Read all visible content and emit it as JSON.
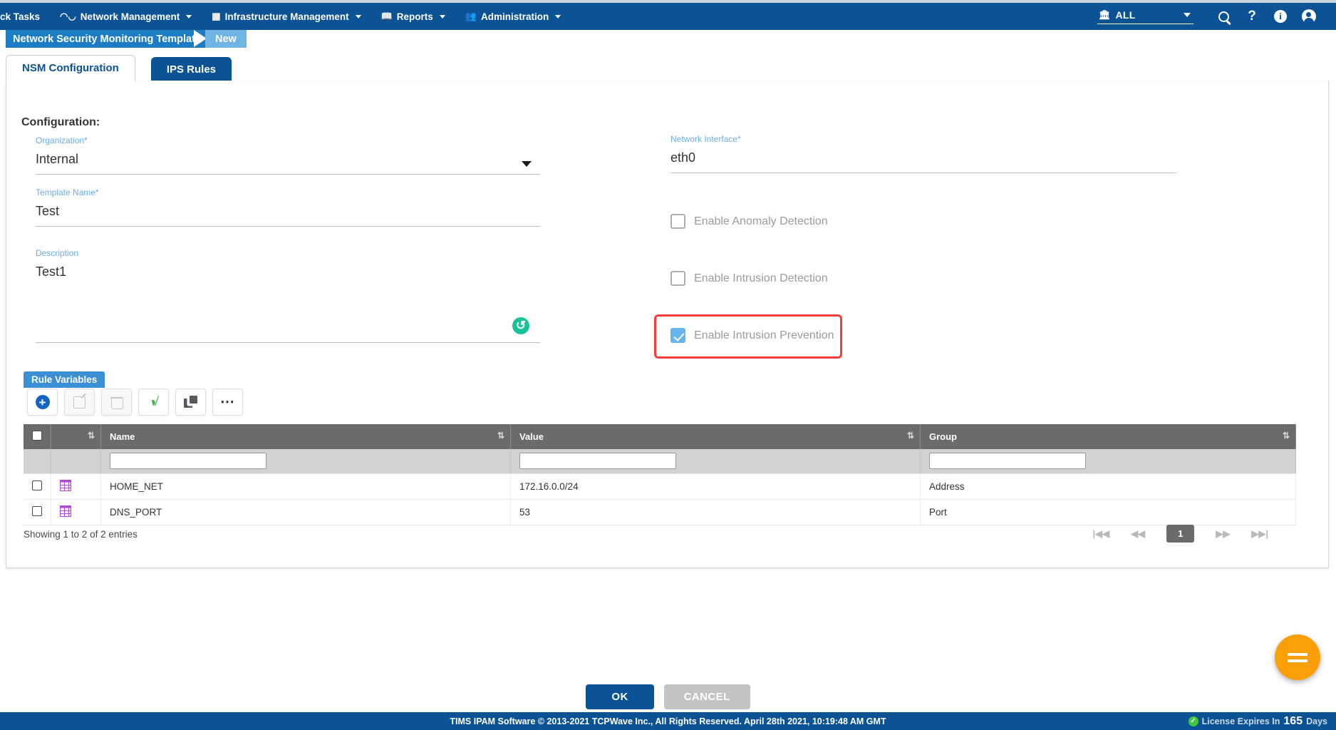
{
  "nav": {
    "items": [
      {
        "label": "ck Tasks",
        "icon": "",
        "caret": false
      },
      {
        "label": "Network Management",
        "icon": "network-icon",
        "caret": true
      },
      {
        "label": "Infrastructure Management",
        "icon": "grid-icon",
        "caret": true
      },
      {
        "label": "Reports",
        "icon": "book-icon",
        "caret": true
      },
      {
        "label": "Administration",
        "icon": "users-icon",
        "caret": true
      }
    ],
    "org_scope": "ALL",
    "right_icons": [
      "search-icon",
      "help-icon",
      "info-icon",
      "user-avatar-icon"
    ]
  },
  "breadcrumb": {
    "parent": "Network Security Monitoring Template",
    "current": "New"
  },
  "tabs": [
    {
      "label": "NSM Configuration",
      "active": true
    },
    {
      "label": "IPS Rules",
      "active": false
    }
  ],
  "form": {
    "section_title": "Configuration:",
    "organization": {
      "label": "Organization*",
      "value": "Internal"
    },
    "template_name": {
      "label": "Template Name*",
      "value": "Test"
    },
    "description": {
      "label": "Description",
      "value": "Test1"
    },
    "network_interface": {
      "label": "Network Interface*",
      "value": "eth0"
    },
    "checkboxes": [
      {
        "label": "Enable Anomaly Detection",
        "checked": false,
        "highlighted": false
      },
      {
        "label": "Enable Intrusion Detection",
        "checked": false,
        "highlighted": false
      },
      {
        "label": "Enable Intrusion Prevention",
        "checked": true,
        "highlighted": true
      }
    ]
  },
  "rule_variables": {
    "tab_label": "Rule Variables",
    "toolbar": [
      {
        "name": "add-button",
        "icon": "plus-icon",
        "disabled": false
      },
      {
        "name": "edit-button",
        "icon": "pencil-icon",
        "disabled": true
      },
      {
        "name": "delete-button",
        "icon": "trash-icon",
        "disabled": true
      },
      {
        "name": "visibility-button",
        "icon": "eye-slash-icon",
        "disabled": false
      },
      {
        "name": "clone-button",
        "icon": "copy-icon",
        "disabled": false
      },
      {
        "name": "more-button",
        "icon": "ellipsis-icon",
        "disabled": false
      }
    ],
    "columns": [
      "",
      "",
      "Name",
      "Value",
      "Group"
    ],
    "filters": {
      "name": "",
      "value": "",
      "group": ""
    },
    "rows": [
      {
        "name": "HOME_NET",
        "value": "172.16.0.0/24",
        "group": "Address"
      },
      {
        "name": "DNS_PORT",
        "value": "53",
        "group": "Port"
      }
    ],
    "showing": "Showing 1 to 2 of 2 entries",
    "pagination": {
      "first": "|◀◀",
      "prev": "◀◀",
      "page": "1",
      "next": "▶▶",
      "last": "▶▶|"
    }
  },
  "actions": {
    "ok": "OK",
    "cancel": "CANCEL"
  },
  "footer": {
    "copyright": "TIMS IPAM Software © 2013-2021 TCPWave Inc., All Rights Reserved.  April 28th 2021, 10:19:48 AM GMT",
    "license_prefix": "License Expires In",
    "license_days": "165",
    "license_suffix": "Days"
  },
  "colors": {
    "nav_blue": "#0b5394",
    "crumb_blue": "#1c7dc4",
    "crumb_light": "#6fb4e3",
    "accent_label": "#6aaee8",
    "highlight_red": "#fb3b3b",
    "fab_orange": "#fb9f08",
    "checkbox_checked": "#64b5f0",
    "table_header": "#6b6b6b",
    "reload_green": "#18c39a",
    "grid_icon_purple": "#b14ad6"
  }
}
